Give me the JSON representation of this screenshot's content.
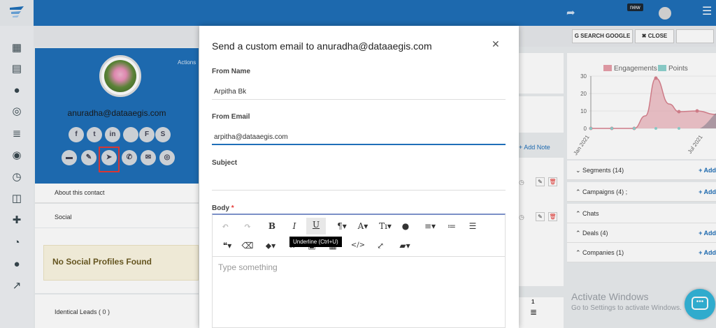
{
  "topbar": {
    "badge": "new"
  },
  "toolbar_buttons": {
    "search_google": "SEARCH GOOGLE",
    "close": "CLOSE"
  },
  "profile": {
    "actions_label": "Actions",
    "email": "anuradha@dataaegis.com",
    "social_icons": [
      "f",
      "t",
      "in",
      "",
      "F",
      "S"
    ],
    "action_icons": [
      "note-icon",
      "edit-icon",
      "send-email-icon",
      "phone-icon",
      "mail-icon",
      "whatsapp-icon"
    ]
  },
  "left_sections": {
    "about": "About this contact",
    "social": "Social",
    "no_profiles": "No Social Profiles Found",
    "identical_leads": "Identical Leads ( 0 )"
  },
  "modal": {
    "title": "Send a custom email to anuradha@dataaegis.com",
    "from_name_label": "From Name",
    "from_name_value": "Arpitha Bk",
    "from_email_label": "From Email",
    "from_email_value": "arpitha@dataaegis.com",
    "subject_label": "Subject",
    "subject_value": "",
    "body_label": "Body",
    "required_mark": "*",
    "body_placeholder": "Type something",
    "tooltip": "Underline (Ctrl+U)"
  },
  "middle": {
    "add_note": "+ Add Note",
    "counter": "1"
  },
  "chart_data": {
    "type": "area",
    "series": [
      {
        "name": "Engagements",
        "color": "#e8a0aa"
      },
      {
        "name": "Points",
        "color": "#8fd3cf"
      }
    ],
    "yticks": [
      "0",
      "10",
      "20",
      "30"
    ],
    "xticks": [
      "Jan 2021",
      "Jul 2021"
    ],
    "ylim": [
      0,
      30
    ]
  },
  "right_panel": {
    "rows": [
      {
        "label": "Segments (14)",
        "add": "+ Add"
      },
      {
        "label": "Campaigns (4) ;",
        "add": "+ Add"
      },
      {
        "label": "Chats",
        "add": ""
      },
      {
        "label": "Deals (4)",
        "add": "+ Add"
      },
      {
        "label": "Companies (1)",
        "add": "+ Add"
      }
    ]
  },
  "watermark": {
    "line1": "Activate Windows",
    "line2": "Go to Settings to activate Windows."
  },
  "colors": {
    "brand": "#1f6fb8",
    "highlight": "#e53935"
  }
}
